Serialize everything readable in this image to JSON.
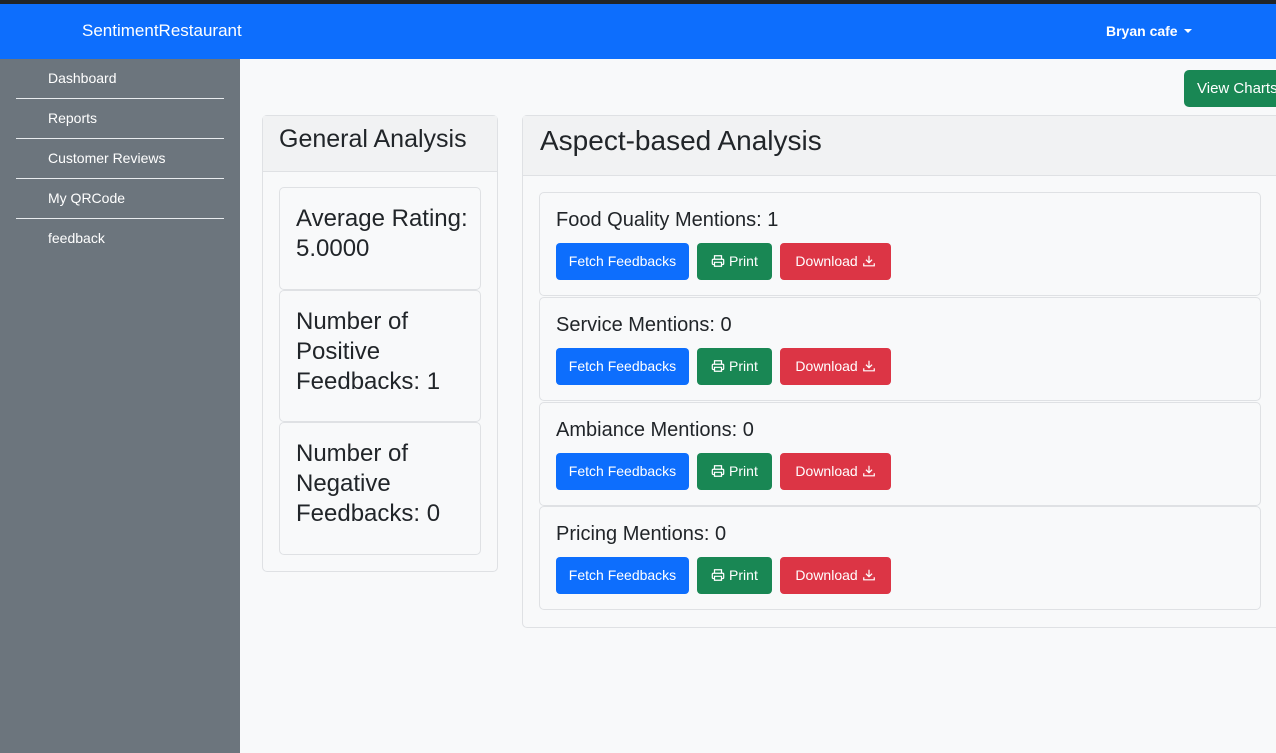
{
  "navbar": {
    "brand": "SentimentRestaurant",
    "user_menu": "Bryan cafe"
  },
  "sidebar": {
    "items": [
      {
        "label": "Dashboard"
      },
      {
        "label": "Reports"
      },
      {
        "label": "Customer Reviews"
      },
      {
        "label": "My QRCode"
      },
      {
        "label": "feedback"
      }
    ]
  },
  "toolbar": {
    "view_charts_label": "View Charts"
  },
  "general_analysis": {
    "title": "General Analysis",
    "stats": [
      {
        "text": "Average Rating: 5.0000"
      },
      {
        "text": "Number of Positive Feedbacks: 1"
      },
      {
        "text": "Number of Negative Feedbacks: 0"
      }
    ]
  },
  "aspect_analysis": {
    "title": "Aspect-based Analysis",
    "fetch_label": "Fetch Feedbacks",
    "print_label": "Print",
    "download_label": "Download",
    "aspects": [
      {
        "title": "Food Quality Mentions: 1"
      },
      {
        "title": "Service Mentions: 0"
      },
      {
        "title": "Ambiance Mentions: 0"
      },
      {
        "title": "Pricing Mentions: 0"
      }
    ]
  },
  "colors": {
    "primary": "#0d6efd",
    "success": "#198754",
    "danger": "#dc3545",
    "sidebar": "#6c757d"
  }
}
